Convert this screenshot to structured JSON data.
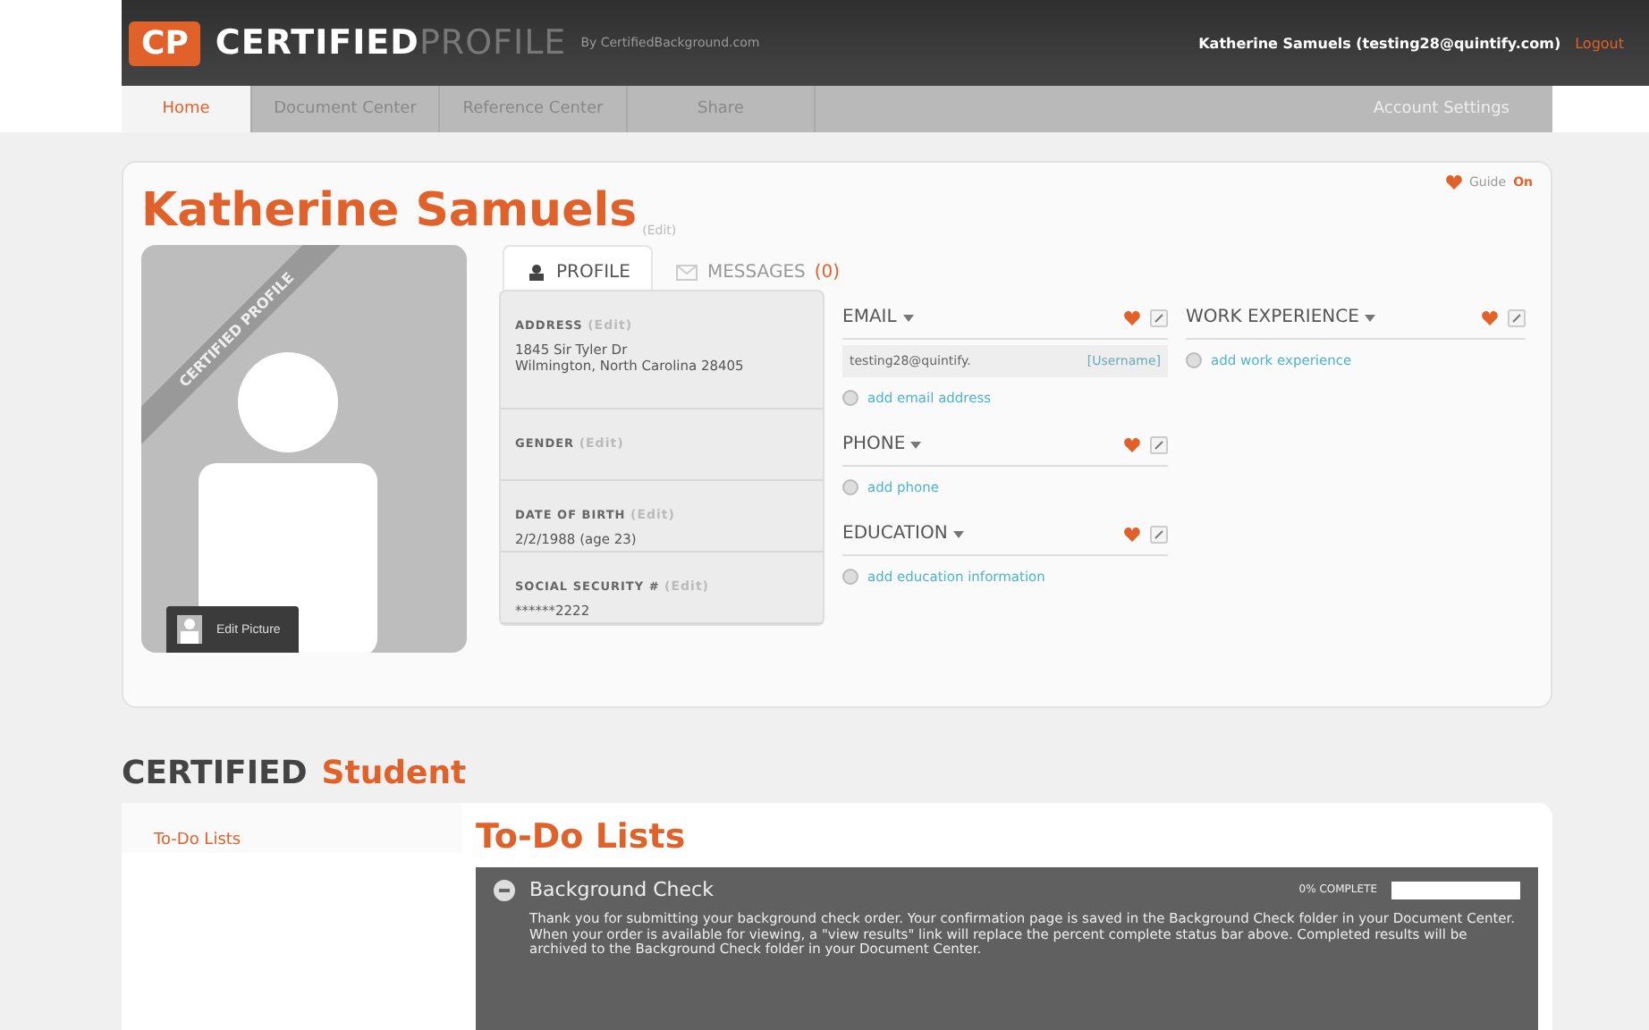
{
  "header": {
    "logo_mark": "CP",
    "brand_bold": "CERTIFIED",
    "brand_light": "PROFILE",
    "byline": "By CertifiedBackground.com",
    "user": "Katherine Samuels (testing28@quintify.com)",
    "logout": "Logout"
  },
  "nav": {
    "tabs": [
      {
        "label": "Home",
        "selected": true
      },
      {
        "label": "Document Center",
        "selected": false
      },
      {
        "label": "Reference Center",
        "selected": false
      },
      {
        "label": "Share",
        "selected": false
      }
    ],
    "account": "Account Settings"
  },
  "profile": {
    "guide": "Guide",
    "guide_state": "On",
    "name": "Katherine Samuels",
    "name_edit": "(Edit)",
    "edit_picture": "Edit Picture",
    "ribbon": "CERTIFIED PROFILE",
    "tabs": [
      {
        "label": "PROFILE",
        "selected": true
      },
      {
        "label": "MESSAGES",
        "count": "(0)",
        "selected": false
      }
    ],
    "fields": [
      {
        "label": "ADDRESS",
        "edit": "(Edit)",
        "lines": [
          "1845 Sir Tyler Dr",
          "Wilmington, North Carolina 28405"
        ]
      },
      {
        "label": "GENDER",
        "edit": "(Edit)"
      },
      {
        "label": "DATE OF BIRTH",
        "edit": "(Edit)",
        "lines": [
          "2/2/1988 (age 23)"
        ]
      },
      {
        "label": "SOCIAL SECURITY #",
        "edit": "(Edit)",
        "lines": [
          "******2222"
        ]
      }
    ],
    "columns": [
      [
        {
          "title": "EMAIL",
          "entries": [
            {
              "kind": "value",
              "value": "testing28@quintify.",
              "tag": "[Username]"
            },
            {
              "kind": "add",
              "label": "add email address"
            }
          ]
        },
        {
          "title": "PHONE",
          "entries": [
            {
              "kind": "add",
              "label": "add phone"
            }
          ]
        },
        {
          "title": "EDUCATION",
          "entries": [
            {
              "kind": "add",
              "label": "add education information"
            }
          ]
        }
      ],
      [
        {
          "title": "WORK EXPERIENCE",
          "entries": [
            {
              "kind": "add",
              "label": "add work experience"
            }
          ]
        }
      ]
    ]
  },
  "section": {
    "title_dark": "CERTIFIED",
    "title_accent": "Student",
    "sidebar": [
      "To-Do Lists"
    ],
    "heading": "To-Do Lists",
    "task": {
      "title": "Background Check",
      "progress_label": "0% COMPLETE",
      "level": 0,
      "text": "Thank you for submitting your background check order. Your confirmation page is saved in the Background Check folder in your Document Center. When your order is available for viewing, a \"view results\" link will replace the percent complete status bar above. Completed results will be archived to the Background Check folder in your Document Center."
    }
  }
}
